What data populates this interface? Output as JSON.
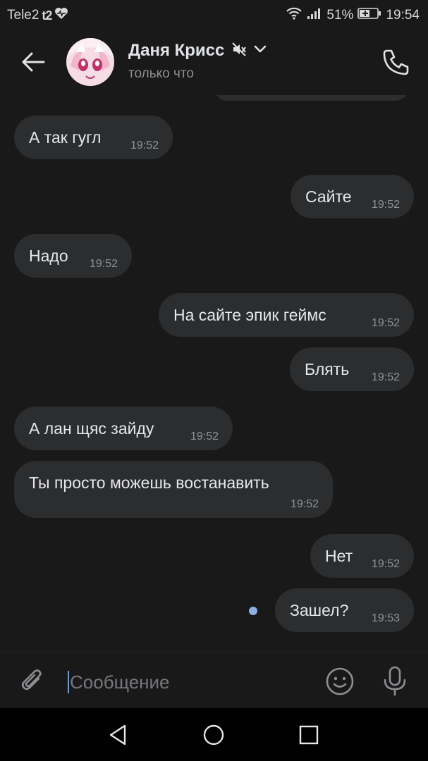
{
  "status_bar": {
    "carrier": "Tele2",
    "operator_logo": "t2",
    "battery": "51%",
    "time": "19:54"
  },
  "header": {
    "contact_name": "Даня Крисс",
    "status": "только что"
  },
  "messages": [
    {
      "text": "А так гугл",
      "time": "19:52",
      "side": "incoming"
    },
    {
      "text": "Сайте",
      "time": "19:52",
      "side": "outgoing"
    },
    {
      "text": "Надо",
      "time": "19:52",
      "side": "incoming"
    },
    {
      "text": "На сайте эпик геймс",
      "time": "19:52",
      "side": "outgoing"
    },
    {
      "text": "Блять",
      "time": "19:52",
      "side": "outgoing"
    },
    {
      "text": "А лан щяс зайду",
      "time": "19:52",
      "side": "incoming"
    },
    {
      "text": "Ты просто можешь востанавить",
      "time": "19:52",
      "side": "incoming"
    },
    {
      "text": "Нет",
      "time": "19:52",
      "side": "outgoing"
    },
    {
      "text": "Зашел?",
      "time": "19:53",
      "side": "outgoing"
    }
  ],
  "composer": {
    "placeholder": "Сообщение"
  },
  "colors": {
    "background": "#19191a",
    "bubble": "#2c2d2e",
    "accent": "#8aafe0"
  },
  "icons": [
    "back-arrow-icon",
    "mute-icon",
    "chevron-down-icon",
    "phone-icon",
    "paperclip-icon",
    "smile-icon",
    "microphone-icon",
    "nav-back-icon",
    "nav-home-icon",
    "nav-recents-icon"
  ]
}
